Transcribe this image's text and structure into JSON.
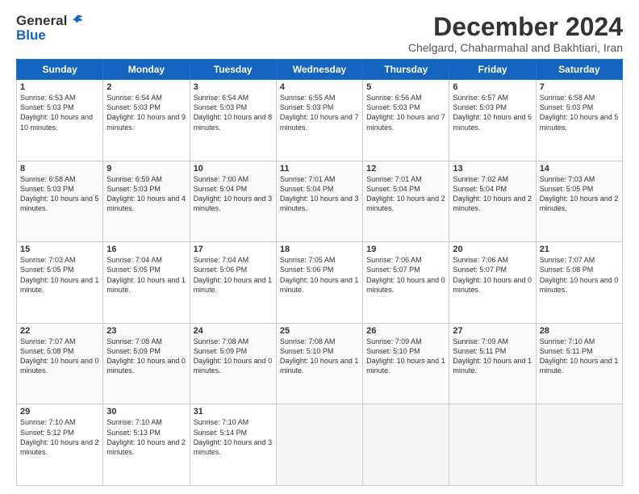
{
  "header": {
    "logo_general": "General",
    "logo_blue": "Blue",
    "month_title": "December 2024",
    "subtitle": "Chelgard, Chaharmahal and Bakhtiari, Iran"
  },
  "days_of_week": [
    "Sunday",
    "Monday",
    "Tuesday",
    "Wednesday",
    "Thursday",
    "Friday",
    "Saturday"
  ],
  "weeks": [
    [
      {
        "num": "1",
        "rise": "6:53 AM",
        "set": "5:03 PM",
        "daylight": "10 hours and 10 minutes."
      },
      {
        "num": "2",
        "rise": "6:54 AM",
        "set": "5:03 PM",
        "daylight": "10 hours and 9 minutes."
      },
      {
        "num": "3",
        "rise": "6:54 AM",
        "set": "5:03 PM",
        "daylight": "10 hours and 8 minutes."
      },
      {
        "num": "4",
        "rise": "6:55 AM",
        "set": "5:03 PM",
        "daylight": "10 hours and 7 minutes."
      },
      {
        "num": "5",
        "rise": "6:56 AM",
        "set": "5:03 PM",
        "daylight": "10 hours and 7 minutes."
      },
      {
        "num": "6",
        "rise": "6:57 AM",
        "set": "5:03 PM",
        "daylight": "10 hours and 6 minutes."
      },
      {
        "num": "7",
        "rise": "6:58 AM",
        "set": "5:03 PM",
        "daylight": "10 hours and 5 minutes."
      }
    ],
    [
      {
        "num": "8",
        "rise": "6:58 AM",
        "set": "5:03 PM",
        "daylight": "10 hours and 5 minutes."
      },
      {
        "num": "9",
        "rise": "6:59 AM",
        "set": "5:03 PM",
        "daylight": "10 hours and 4 minutes."
      },
      {
        "num": "10",
        "rise": "7:00 AM",
        "set": "5:04 PM",
        "daylight": "10 hours and 3 minutes."
      },
      {
        "num": "11",
        "rise": "7:01 AM",
        "set": "5:04 PM",
        "daylight": "10 hours and 3 minutes."
      },
      {
        "num": "12",
        "rise": "7:01 AM",
        "set": "5:04 PM",
        "daylight": "10 hours and 2 minutes."
      },
      {
        "num": "13",
        "rise": "7:02 AM",
        "set": "5:04 PM",
        "daylight": "10 hours and 2 minutes."
      },
      {
        "num": "14",
        "rise": "7:03 AM",
        "set": "5:05 PM",
        "daylight": "10 hours and 2 minutes."
      }
    ],
    [
      {
        "num": "15",
        "rise": "7:03 AM",
        "set": "5:05 PM",
        "daylight": "10 hours and 1 minute."
      },
      {
        "num": "16",
        "rise": "7:04 AM",
        "set": "5:05 PM",
        "daylight": "10 hours and 1 minute."
      },
      {
        "num": "17",
        "rise": "7:04 AM",
        "set": "5:06 PM",
        "daylight": "10 hours and 1 minute."
      },
      {
        "num": "18",
        "rise": "7:05 AM",
        "set": "5:06 PM",
        "daylight": "10 hours and 1 minute."
      },
      {
        "num": "19",
        "rise": "7:06 AM",
        "set": "5:07 PM",
        "daylight": "10 hours and 0 minutes."
      },
      {
        "num": "20",
        "rise": "7:06 AM",
        "set": "5:07 PM",
        "daylight": "10 hours and 0 minutes."
      },
      {
        "num": "21",
        "rise": "7:07 AM",
        "set": "5:08 PM",
        "daylight": "10 hours and 0 minutes."
      }
    ],
    [
      {
        "num": "22",
        "rise": "7:07 AM",
        "set": "5:08 PM",
        "daylight": "10 hours and 0 minutes."
      },
      {
        "num": "23",
        "rise": "7:08 AM",
        "set": "5:09 PM",
        "daylight": "10 hours and 0 minutes."
      },
      {
        "num": "24",
        "rise": "7:08 AM",
        "set": "5:09 PM",
        "daylight": "10 hours and 0 minutes."
      },
      {
        "num": "25",
        "rise": "7:08 AM",
        "set": "5:10 PM",
        "daylight": "10 hours and 1 minute."
      },
      {
        "num": "26",
        "rise": "7:09 AM",
        "set": "5:10 PM",
        "daylight": "10 hours and 1 minute."
      },
      {
        "num": "27",
        "rise": "7:09 AM",
        "set": "5:11 PM",
        "daylight": "10 hours and 1 minute."
      },
      {
        "num": "28",
        "rise": "7:10 AM",
        "set": "5:11 PM",
        "daylight": "10 hours and 1 minute."
      }
    ],
    [
      {
        "num": "29",
        "rise": "7:10 AM",
        "set": "5:12 PM",
        "daylight": "10 hours and 2 minutes."
      },
      {
        "num": "30",
        "rise": "7:10 AM",
        "set": "5:13 PM",
        "daylight": "10 hours and 2 minutes."
      },
      {
        "num": "31",
        "rise": "7:10 AM",
        "set": "5:14 PM",
        "daylight": "10 hours and 3 minutes."
      },
      null,
      null,
      null,
      null
    ]
  ]
}
